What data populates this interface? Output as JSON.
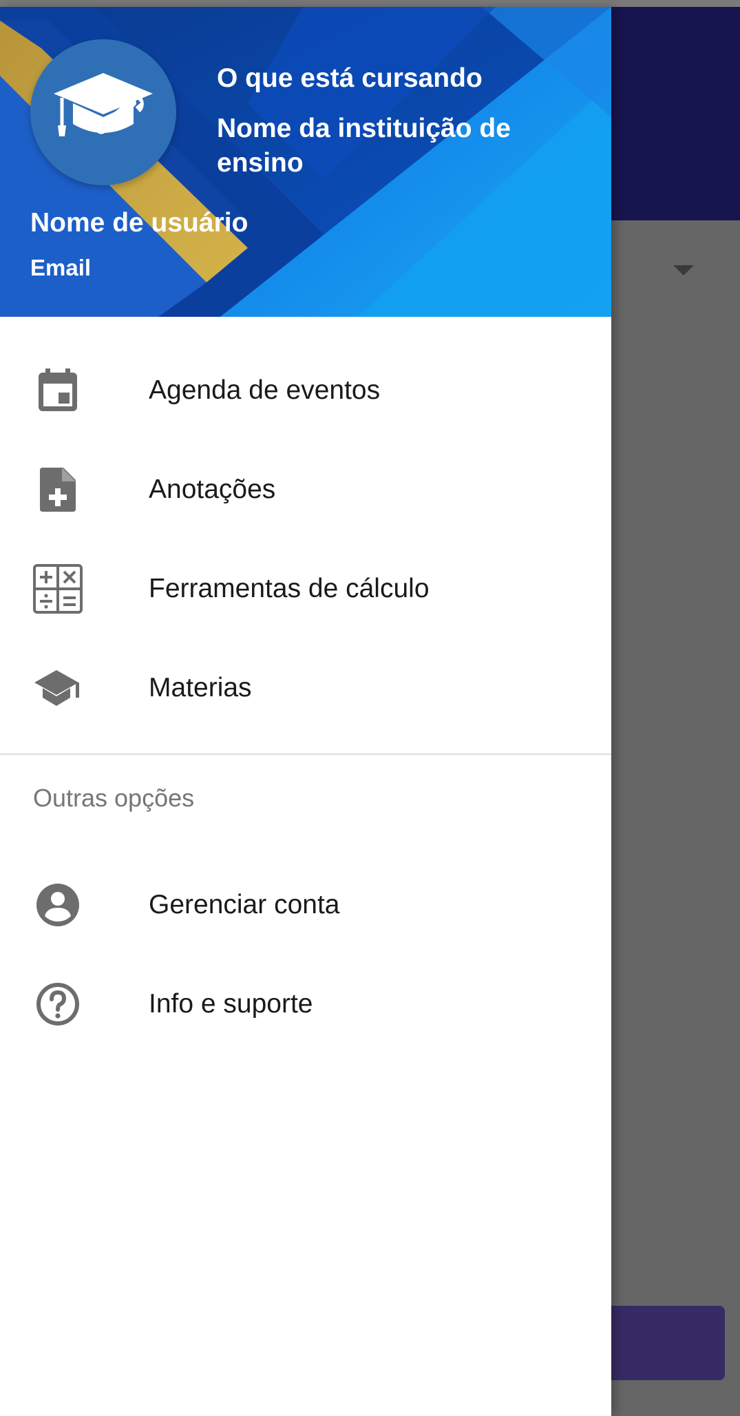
{
  "drawer": {
    "header": {
      "course": "O que está cursando",
      "institution": "Nome da instituição de ensino",
      "username": "Nome de usuário",
      "email": "Email",
      "avatar_icon": "graduation-cap-wrench-icon"
    },
    "main_items": [
      {
        "label": "Agenda de eventos",
        "icon": "calendar-icon"
      },
      {
        "label": "Anotações",
        "icon": "note-add-icon"
      },
      {
        "label": "Ferramentas de cálculo",
        "icon": "calculator-icon"
      },
      {
        "label": "Materias",
        "icon": "school-icon"
      }
    ],
    "section_title": "Outras opções",
    "other_items": [
      {
        "label": "Gerenciar conta",
        "icon": "account-circle-icon"
      },
      {
        "label": "Info e suporte",
        "icon": "help-circle-icon"
      }
    ]
  },
  "colors": {
    "header_blue": "#0a47b8",
    "header_light_blue": "#1aa0f0",
    "gold_stripe": "#c9a437",
    "avatar": "#2f6fb6",
    "icon_gray": "#6d6d6d",
    "appbar": "#17154f",
    "scrim": "#666666",
    "fab": "#372b66"
  }
}
